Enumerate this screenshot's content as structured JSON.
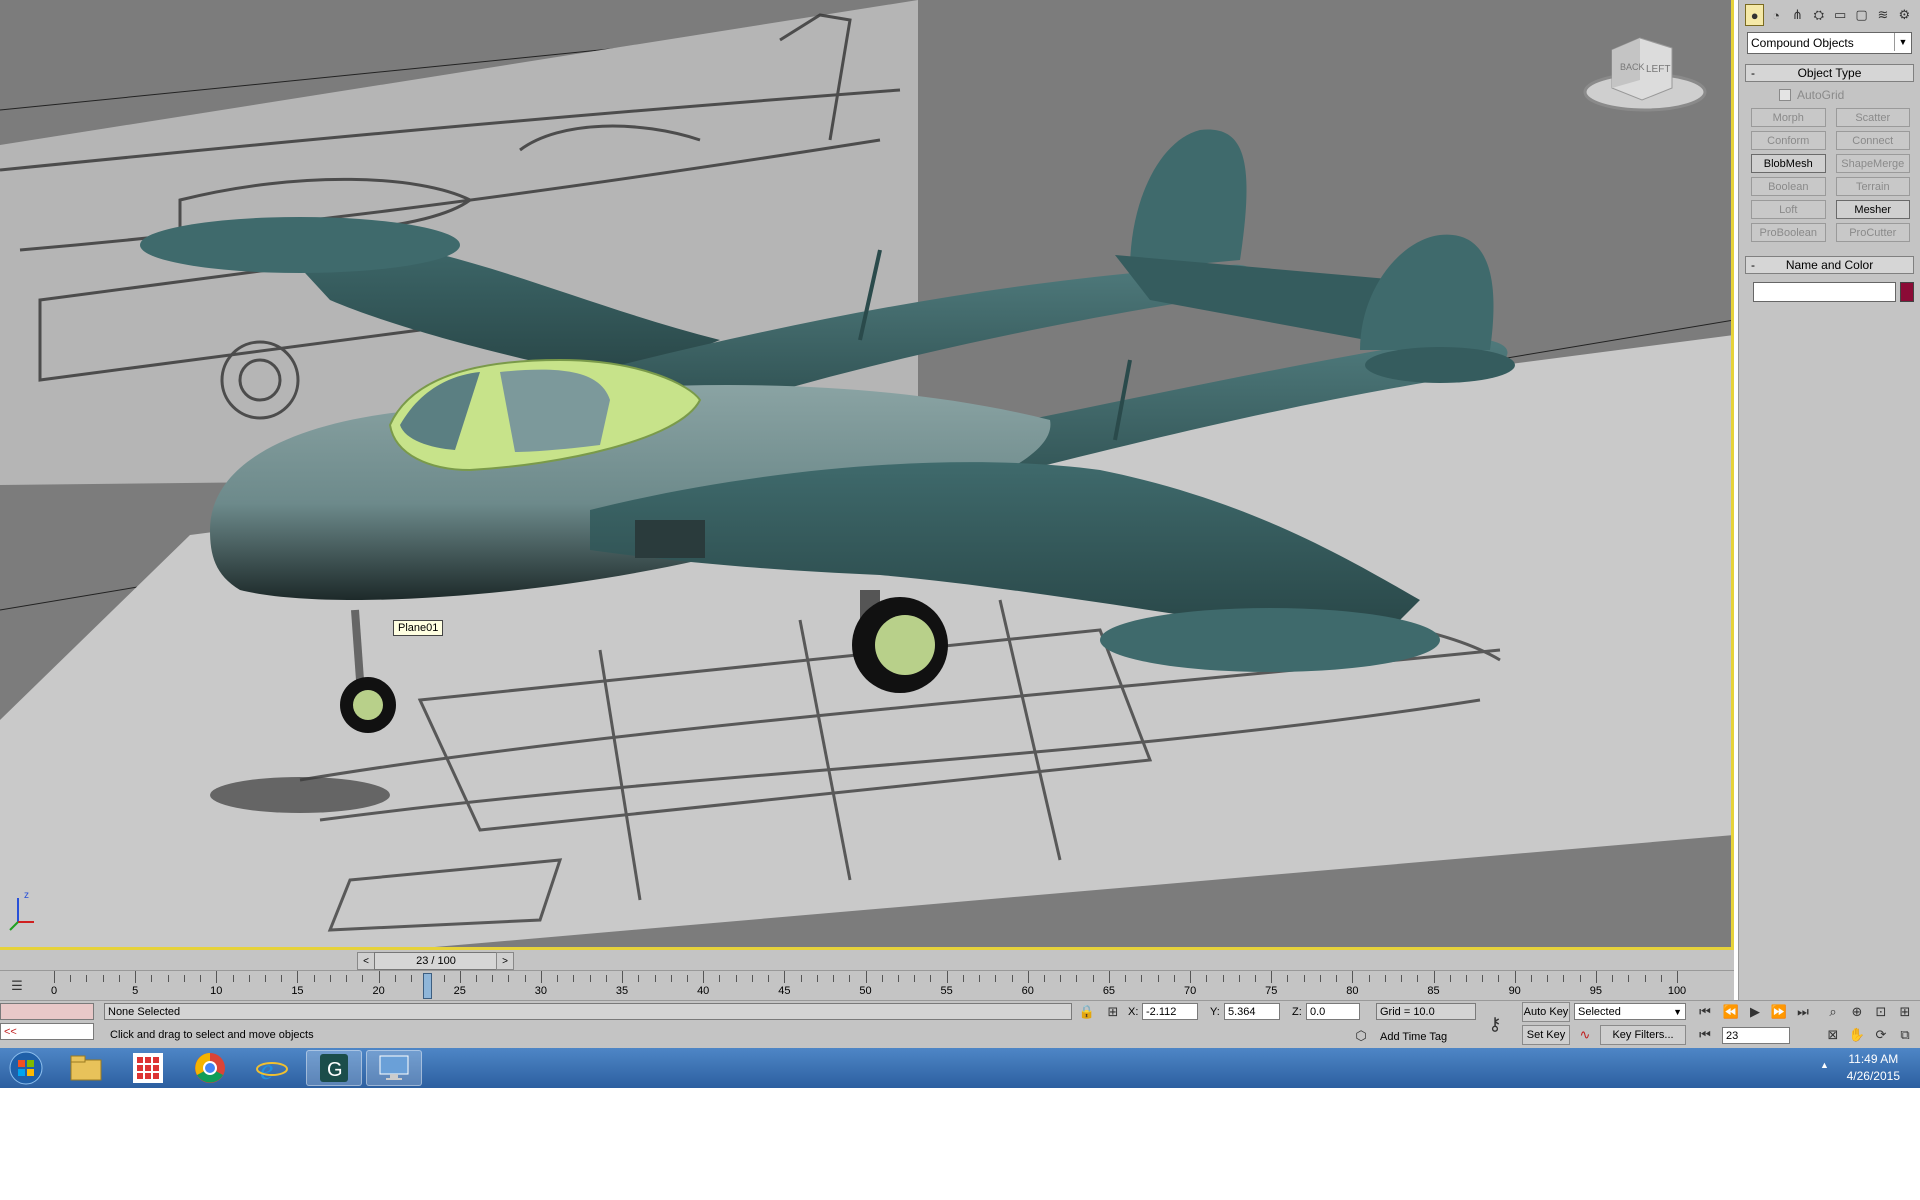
{
  "viewport": {
    "object_label": "Plane01",
    "viewcube": {
      "left": "LEFT",
      "back": "BACK"
    },
    "axis": {
      "z": "z",
      "x": "x",
      "y": "y"
    }
  },
  "command_panel": {
    "tab_icons": [
      "create-icon",
      "modify-icon",
      "hierarchy-icon",
      "motion-icon",
      "display-icon",
      "utilities-icon",
      "more-icon",
      "settings-icon"
    ],
    "category": "Compound Objects",
    "object_type": {
      "title": "Object Type",
      "autogrid": "AutoGrid",
      "buttons": [
        {
          "label": "Morph",
          "on": false
        },
        {
          "label": "Scatter",
          "on": false
        },
        {
          "label": "Conform",
          "on": false
        },
        {
          "label": "Connect",
          "on": false
        },
        {
          "label": "BlobMesh",
          "on": true
        },
        {
          "label": "ShapeMerge",
          "on": false
        },
        {
          "label": "Boolean",
          "on": false
        },
        {
          "label": "Terrain",
          "on": false
        },
        {
          "label": "Loft",
          "on": false
        },
        {
          "label": "Mesher",
          "on": true
        },
        {
          "label": "ProBoolean",
          "on": false
        },
        {
          "label": "ProCutter",
          "on": false
        }
      ]
    },
    "name_color": {
      "title": "Name and Color",
      "name_value": "",
      "color": "#8b0b36"
    }
  },
  "timeslider": {
    "frame_display": "23 / 100",
    "prev": "<",
    "next": ">"
  },
  "trackbar": {
    "labels": [
      "0",
      "5",
      "10",
      "15",
      "20",
      "25",
      "30",
      "35",
      "40",
      "45",
      "50",
      "55",
      "60",
      "65",
      "70",
      "75",
      "80",
      "85",
      "90",
      "95",
      "100"
    ],
    "current_frame": 23
  },
  "status": {
    "maxscript_arrow": "<<",
    "selection": "None Selected",
    "prompt": "Click and drag to select and move objects",
    "x_label": "X:",
    "x_value": "-2.112",
    "y_label": "Y:",
    "y_value": "5.364",
    "z_label": "Z:",
    "z_value": "0.0",
    "grid": "Grid = 10.0",
    "add_time_tag": "Add Time Tag",
    "auto_key": "Auto Key",
    "set_key": "Set Key",
    "selected_dropdown": "Selected",
    "key_filters": "Key Filters...",
    "frame_field": "23"
  },
  "taskbar": {
    "items": [
      "start-orb-icon",
      "file-explorer-icon",
      "metro-apps-icon",
      "chrome-icon",
      "internet-explorer-icon",
      "3ds-max-icon",
      "remote-desktop-icon"
    ],
    "time": "11:49 AM",
    "date": "4/26/2015",
    "tray_arrow": "▲"
  }
}
